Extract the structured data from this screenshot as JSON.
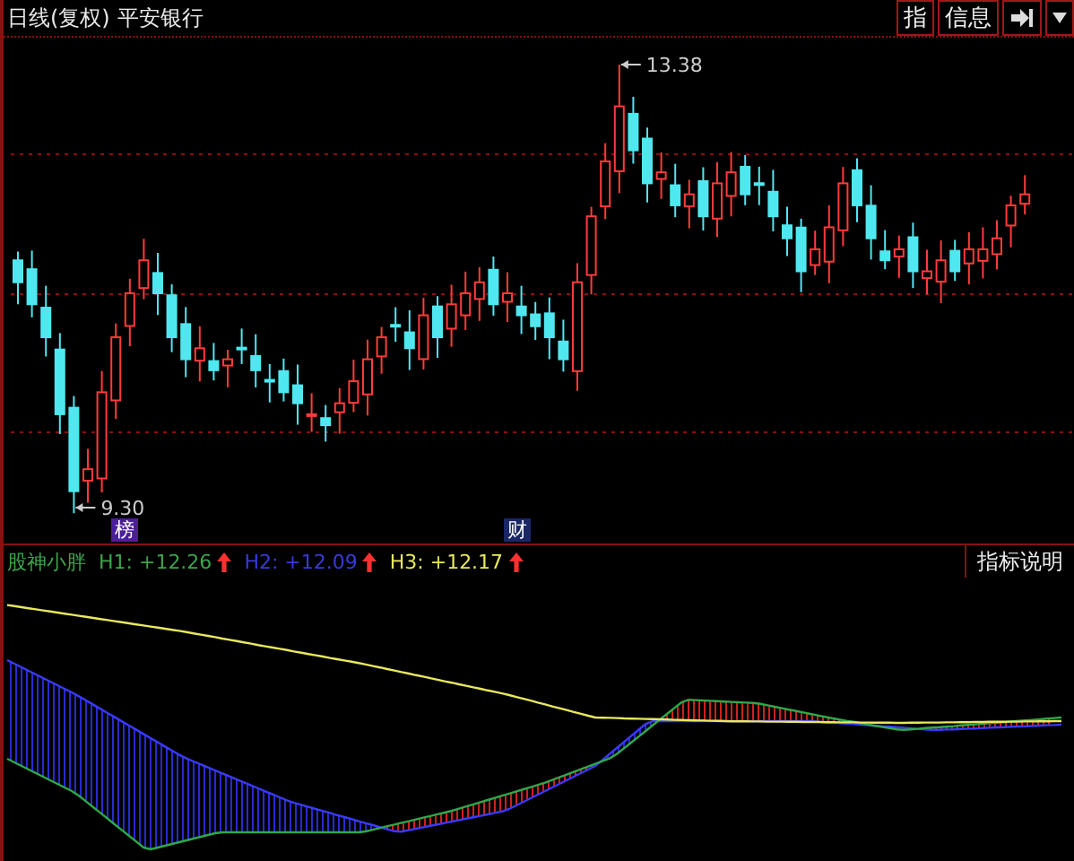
{
  "header": {
    "period": "日线(复权)",
    "stock": "平安银行",
    "buttons": [
      {
        "label": "指"
      },
      {
        "label": "信息"
      }
    ]
  },
  "price_chart": {
    "high_label": "13.38",
    "low_label": "9.30",
    "tags": [
      {
        "label": "榜",
        "color": "#4b1f96"
      },
      {
        "label": "财",
        "color": "#1a2766"
      }
    ]
  },
  "indicator": {
    "name": "股神小胖",
    "help_button": "指标说明",
    "values": [
      {
        "label": "H1: +12.26",
        "color": "#3fa34d",
        "rising": true
      },
      {
        "label": "H2: +12.09",
        "color": "#3a3ad8",
        "rising": true
      },
      {
        "label": "H3: +12.17",
        "color": "#e8e860",
        "rising": true
      }
    ]
  }
}
